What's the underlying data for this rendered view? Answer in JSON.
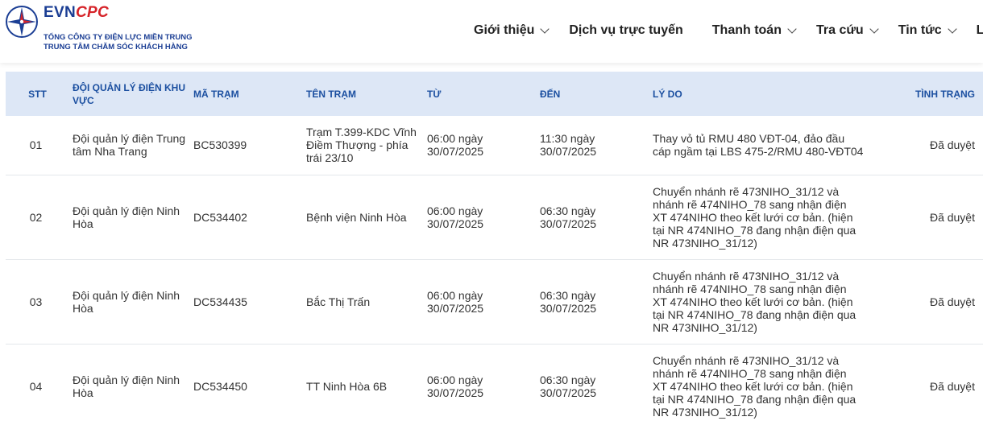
{
  "header": {
    "brand_evn": "EVN",
    "brand_cpc": "CPC",
    "subtitle_1": "TỔNG CÔNG TY ĐIỆN LỰC MIỀN TRUNG",
    "subtitle_2": "TRUNG TÂM CHĂM SÓC KHÁCH HÀNG"
  },
  "nav": {
    "items": [
      {
        "label": "Giới thiệu",
        "has_dropdown": true
      },
      {
        "label": "Dịch vụ trực tuyến",
        "has_dropdown": false
      },
      {
        "label": "Thanh toán",
        "has_dropdown": true
      },
      {
        "label": "Tra cứu",
        "has_dropdown": true
      },
      {
        "label": "Tin tức",
        "has_dropdown": true
      },
      {
        "label": "Liên",
        "has_dropdown": false
      }
    ]
  },
  "table": {
    "columns": [
      "STT",
      "ĐỘI QUẢN LÝ ĐIỆN KHU VỰC",
      "MÃ TRẠM",
      "TÊN TRẠM",
      "TỪ",
      "ĐẾN",
      "LÝ DO",
      "TÌNH TRẠNG"
    ],
    "rows": [
      {
        "stt": "01",
        "doi": "Đội quản lý điện Trung tâm Nha Trang",
        "ma": "BC530399",
        "ten": "Trạm T.399-KDC Vĩnh Điềm Thượng - phía trái 23/10",
        "tu": "06:00 ngày 30/07/2025",
        "den": "11:30 ngày 30/07/2025",
        "lydo": "Thay vỏ tủ RMU 480 VĐT-04, đảo đầu cáp ngầm tại LBS 475-2/RMU 480-VĐT04",
        "status": "Đã duyệt"
      },
      {
        "stt": "02",
        "doi": "Đội quản lý điện Ninh Hòa",
        "ma": "DC534402",
        "ten": "Bệnh viện Ninh Hòa",
        "tu": "06:00 ngày 30/07/2025",
        "den": "06:30 ngày 30/07/2025",
        "lydo": "Chuyển nhánh rẽ 473NIHO_31/12 và nhánh rẽ 474NIHO_78 sang nhận điện XT 474NIHO theo kết lưới cơ bản. (hiện tại NR 474NIHO_78 đang nhận điện qua NR 473NIHO_31/12)",
        "status": "Đã duyệt"
      },
      {
        "stt": "03",
        "doi": "Đội quản lý điện Ninh Hòa",
        "ma": "DC534435",
        "ten": "Bắc Thị Trấn",
        "tu": "06:00 ngày 30/07/2025",
        "den": "06:30 ngày 30/07/2025",
        "lydo": "Chuyển nhánh rẽ 473NIHO_31/12 và nhánh rẽ 474NIHO_78 sang nhận điện XT 474NIHO theo kết lưới cơ bản. (hiện tại NR 474NIHO_78 đang nhận điện qua NR 473NIHO_31/12)",
        "status": "Đã duyệt"
      },
      {
        "stt": "04",
        "doi": "Đội quản lý điện Ninh Hòa",
        "ma": "DC534450",
        "ten": "TT Ninh Hòa 6B",
        "tu": "06:00 ngày 30/07/2025",
        "den": "06:30 ngày 30/07/2025",
        "lydo": "Chuyển nhánh rẽ 473NIHO_31/12 và nhánh rẽ 474NIHO_78 sang nhận điện XT 474NIHO theo kết lưới cơ bản. (hiện tại NR 474NIHO_78 đang nhận điện qua NR 473NIHO_31/12)",
        "status": "Đã duyệt"
      }
    ]
  },
  "colors": {
    "brand_blue": "#1b3e94",
    "brand_red": "#d6242a",
    "header_row_bg": "#dde7f6",
    "header_text": "#1b4fa0"
  }
}
